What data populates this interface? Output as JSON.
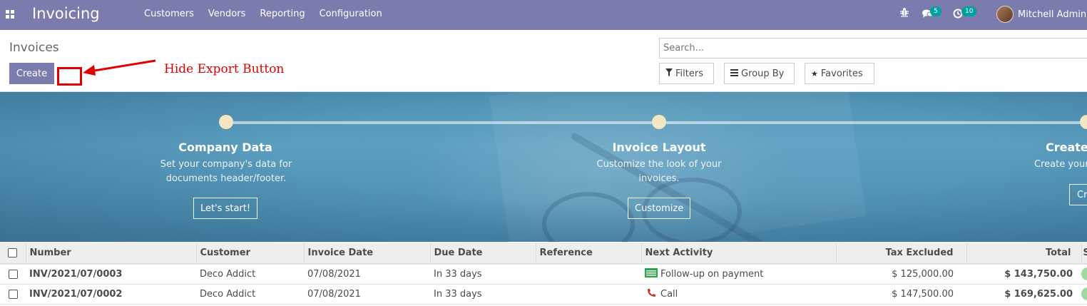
{
  "navbar": {
    "app_name": "Invoicing",
    "menu": [
      "Customers",
      "Vendors",
      "Reporting",
      "Configuration"
    ],
    "messages_count": "5",
    "activities_count": "10",
    "user_name": "Mitchell Admin",
    "icons": [
      "apps-icon",
      "bug-icon",
      "chat-icon",
      "clock-icon"
    ]
  },
  "control_panel": {
    "breadcrumb": "Invoices",
    "create_label": "Create",
    "annotation_text": "Hide Export Button",
    "search_placeholder": "Search...",
    "filters_label": "Filters",
    "groupby_label": "Group By",
    "favorites_label": "Favorites"
  },
  "onboarding": {
    "steps": [
      {
        "title": "Company Data",
        "description_line1": "Set your company's data for",
        "description_line2": "documents header/footer.",
        "button": "Let's start!"
      },
      {
        "title": "Invoice Layout",
        "description_line1": "Customize the look of your",
        "description_line2": "invoices.",
        "button": "Customize"
      },
      {
        "title": "Create",
        "description_line1": "Create your",
        "description_line2": "",
        "button": "Cr"
      }
    ]
  },
  "table": {
    "columns": [
      "Number",
      "Customer",
      "Invoice Date",
      "Due Date",
      "Reference",
      "Next Activity",
      "Tax Excluded",
      "Total",
      "S"
    ],
    "rows": [
      {
        "number": "INV/2021/07/0003",
        "customer": "Deco Addict",
        "invoice_date": "07/08/2021",
        "due_date": "In 33 days",
        "reference": "",
        "activity": "Follow-up on payment",
        "activity_icon": "cash-icon",
        "tax_excluded": "$ 125,000.00",
        "total": "$ 143,750.00"
      },
      {
        "number": "INV/2021/07/0002",
        "customer": "Deco Addict",
        "invoice_date": "07/08/2021",
        "due_date": "In 33 days",
        "reference": "",
        "activity": "Call",
        "activity_icon": "phone-icon",
        "tax_excluded": "$ 147,500.00",
        "total": "$ 169,625.00"
      }
    ]
  },
  "colors": {
    "brand": "#7c7bad",
    "badge": "#00a09d",
    "annotation": "#e00000",
    "banner": "#4f93b4",
    "step_dot": "#f4e5c3"
  }
}
